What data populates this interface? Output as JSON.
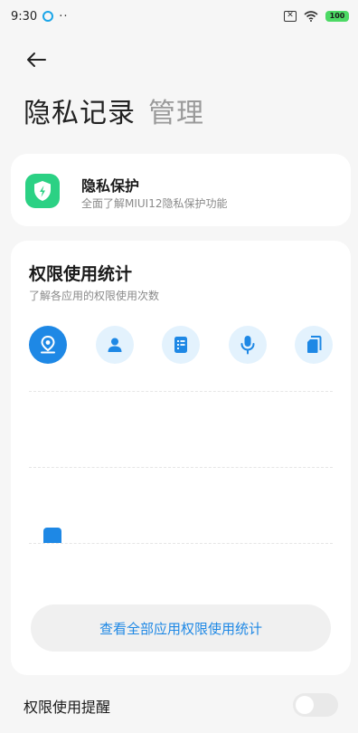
{
  "status_bar": {
    "time": "9:30",
    "dots": "··",
    "battery": "100"
  },
  "header": {
    "title_main": "隐私记录",
    "title_secondary": "管理"
  },
  "privacy_card": {
    "title": "隐私保护",
    "subtitle": "全面了解MIUI12隐私保护功能",
    "icon": "shield-icon",
    "icon_color": "#2bd184"
  },
  "stats_card": {
    "title": "权限使用统计",
    "subtitle": "了解各应用的权限使用次数",
    "permission_icons": [
      {
        "name": "location-icon",
        "selected": true
      },
      {
        "name": "contacts-icon",
        "selected": false
      },
      {
        "name": "call-log-icon",
        "selected": false
      },
      {
        "name": "microphone-icon",
        "selected": false
      },
      {
        "name": "storage-icon",
        "selected": false
      }
    ],
    "accent_color": "#1e88e5",
    "view_all_label": "查看全部应用权限使用统计"
  },
  "chart_data": {
    "type": "bar",
    "categories": [
      ""
    ],
    "values": [
      1
    ],
    "ylim": [
      0,
      10
    ],
    "grid": true,
    "title": "",
    "xlabel": "",
    "ylabel": ""
  },
  "reminder": {
    "label": "权限使用提醒",
    "enabled": false
  }
}
